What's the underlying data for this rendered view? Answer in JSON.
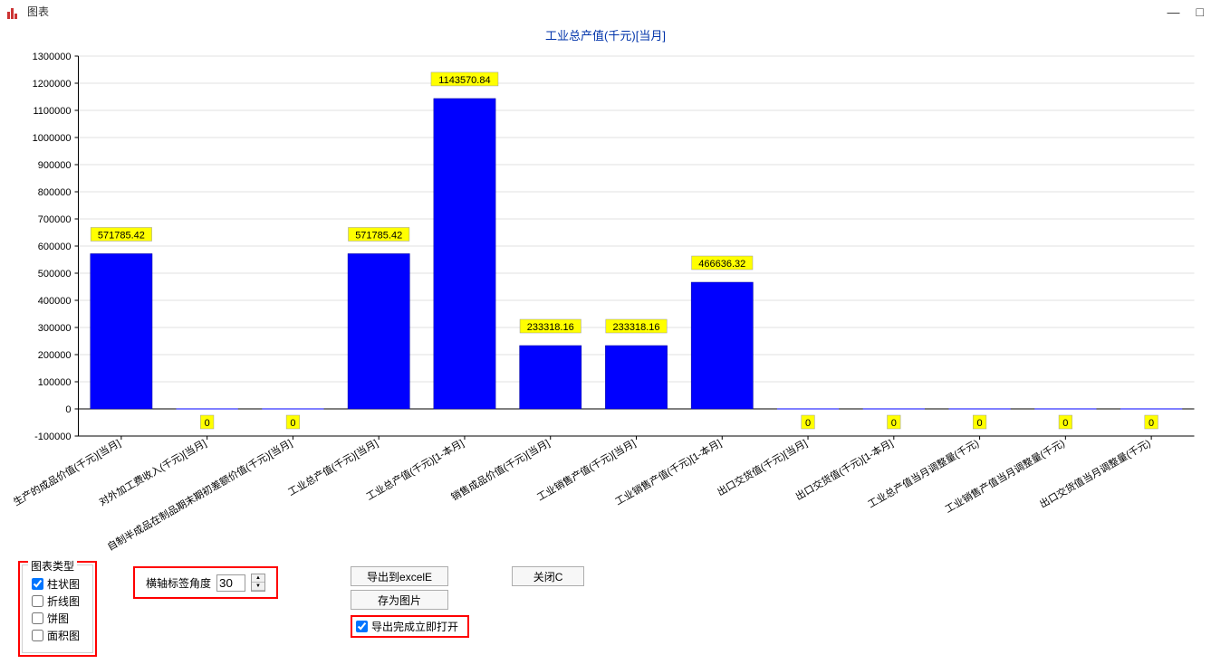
{
  "window": {
    "title": "图表",
    "minimize": "—",
    "maximize": "□"
  },
  "chart_data": {
    "type": "bar",
    "title": "工业总产值(千元)[当月]",
    "categories": [
      "生产的成品价值(千元)[当月]",
      "对外加工费收入(千元)[当月]",
      "自制半成品在制品期末期初差额价值(千元)[当月]",
      "工业总产值(千元)[当月]",
      "工业总产值(千元)[1-本月]",
      "销售成品价值(千元)[当月]",
      "工业销售产值(千元)[当月]",
      "工业销售产值(千元)[1-本月]",
      "出口交货值(千元)[当月]",
      "出口交货值(千元)[1-本月]",
      "工业总产值当月调整量(千元)",
      "工业销售产值当月调整量(千元)",
      "出口交货值当月调整量(千元)"
    ],
    "values": [
      571785.42,
      0,
      0,
      571785.42,
      1143570.84,
      233318.16,
      233318.16,
      466636.32,
      0,
      0,
      0,
      0,
      0
    ],
    "ylim": [
      -100000,
      1300000
    ],
    "yticks": [
      -100000,
      0,
      100000,
      200000,
      300000,
      400000,
      500000,
      600000,
      700000,
      800000,
      900000,
      1000000,
      1100000,
      1200000,
      1300000
    ],
    "xlabel": "",
    "ylabel": ""
  },
  "controls": {
    "chart_type_legend": "图表类型",
    "bar_chart": "柱状图",
    "line_chart": "折线图",
    "pie_chart": "饼图",
    "area_chart": "面积图",
    "xaxis_angle_label": "横轴标签角度",
    "xaxis_angle_value": "30",
    "export_excel": "导出到excelE",
    "save_image": "存为图片",
    "close": "关闭C",
    "open_after_export": "导出完成立即打开"
  }
}
